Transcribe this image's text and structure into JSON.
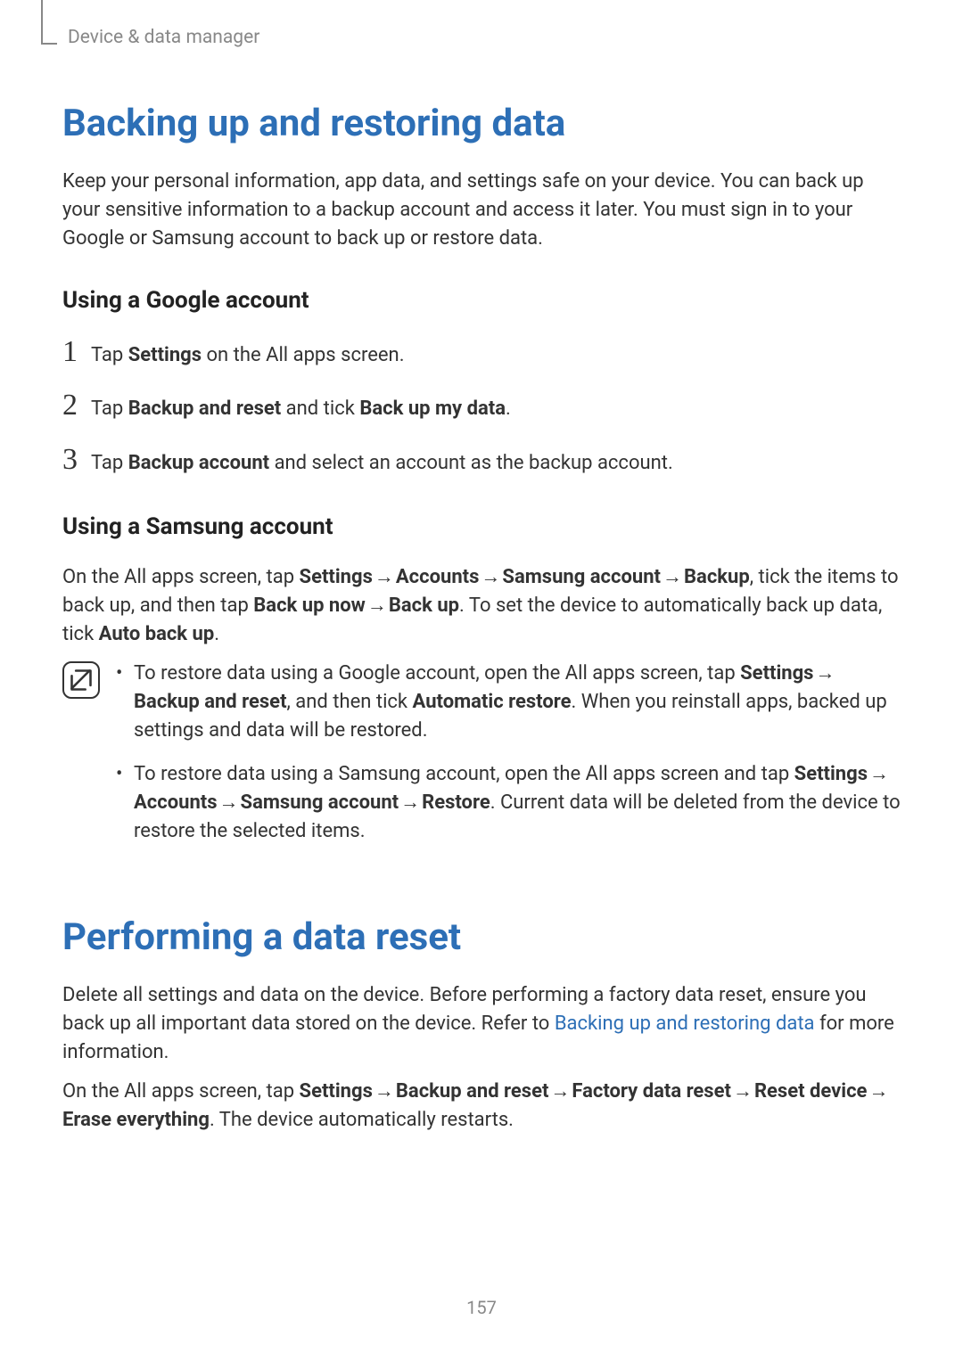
{
  "header": {
    "breadcrumb": "Device & data manager"
  },
  "section1": {
    "title": "Backing up and restoring data",
    "intro": "Keep your personal information, app data, and settings safe on your device. You can back up your sensitive information to a backup account and access it later. You must sign in to your Google or Samsung account to back up or restore data.",
    "sub1": {
      "title": "Using a Google account",
      "steps": {
        "s1": {
          "num": "1",
          "pre": "Tap ",
          "b1": "Settings",
          "post": " on the All apps screen."
        },
        "s2": {
          "num": "2",
          "pre": "Tap ",
          "b1": "Backup and reset",
          "mid": " and tick ",
          "b2": "Back up my data",
          "post": "."
        },
        "s3": {
          "num": "3",
          "pre": "Tap ",
          "b1": "Backup account",
          "post": " and select an account as the backup account."
        }
      }
    },
    "sub2": {
      "title": "Using a Samsung account",
      "para": {
        "t1": "On the All apps screen, tap ",
        "b1": "Settings",
        "arr1": " → ",
        "b2": "Accounts",
        "arr2": " → ",
        "b3": "Samsung account",
        "arr3": " → ",
        "b4": "Backup",
        "t2": ", tick the items to back up, and then tap ",
        "b5": "Back up now",
        "arr4": " → ",
        "b6": "Back up",
        "t3": ". To set the device to automatically back up data, tick ",
        "b7": "Auto back up",
        "t4": "."
      },
      "note": {
        "li1": {
          "t1": "To restore data using a Google account, open the All apps screen, tap ",
          "b1": "Settings",
          "arr1": " → ",
          "b2": "Backup and reset",
          "t2": ", and then tick ",
          "b3": "Automatic restore",
          "t3": ". When you reinstall apps, backed up settings and data will be restored."
        },
        "li2": {
          "t1": "To restore data using a Samsung account, open the All apps screen and tap ",
          "b1": "Settings",
          "arr1": " → ",
          "b2": "Accounts",
          "arr2": " → ",
          "b3": "Samsung account",
          "arr3": " → ",
          "b4": "Restore",
          "t2": ". Current data will be deleted from the device to restore the selected items."
        }
      }
    }
  },
  "section2": {
    "title": "Performing a data reset",
    "para1": {
      "t1": "Delete all settings and data on the device. Before performing a factory data reset, ensure you back up all important data stored on the device. Refer to ",
      "link": "Backing up and restoring data",
      "t2": " for more information."
    },
    "para2": {
      "t1": "On the All apps screen, tap ",
      "b1": "Settings",
      "arr1": " → ",
      "b2": "Backup and reset",
      "arr2": " → ",
      "b3": "Factory data reset",
      "arr3": " → ",
      "b4": "Reset device",
      "arr4": " → ",
      "b5": "Erase everything",
      "t2": ". The device automatically restarts."
    }
  },
  "pageNumber": "157"
}
